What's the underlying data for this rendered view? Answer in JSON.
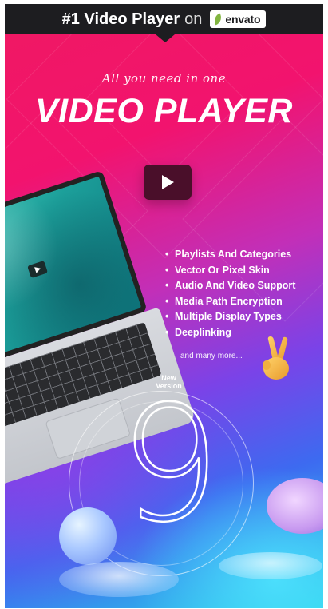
{
  "header": {
    "title": "#1 Video Player",
    "connector": "on",
    "brand": "envato"
  },
  "hero": {
    "tagline": "All you need in one",
    "title": "VIDEO PLAYER"
  },
  "features": [
    "Playlists And Categories",
    "Vector Or Pixel Skin",
    "Audio And Video Support",
    "Media Path Encryption",
    "Multiple Display Types",
    "Deeplinking"
  ],
  "more_text": "and many more...",
  "version": {
    "label_line1": "New",
    "label_line2": "Version",
    "number": "9"
  },
  "colors": {
    "topbar": "#1d1d20",
    "envato_green": "#82b541",
    "gradient_pink": "#f01864",
    "gradient_purple": "#7a43e8",
    "gradient_cyan": "#2ad0e8",
    "play_button": "#4a0f2a"
  },
  "icons": {
    "play": "play-triangle-icon",
    "envato_logo": "envato-leaf-icon",
    "hand": "peace-hand-icon"
  }
}
